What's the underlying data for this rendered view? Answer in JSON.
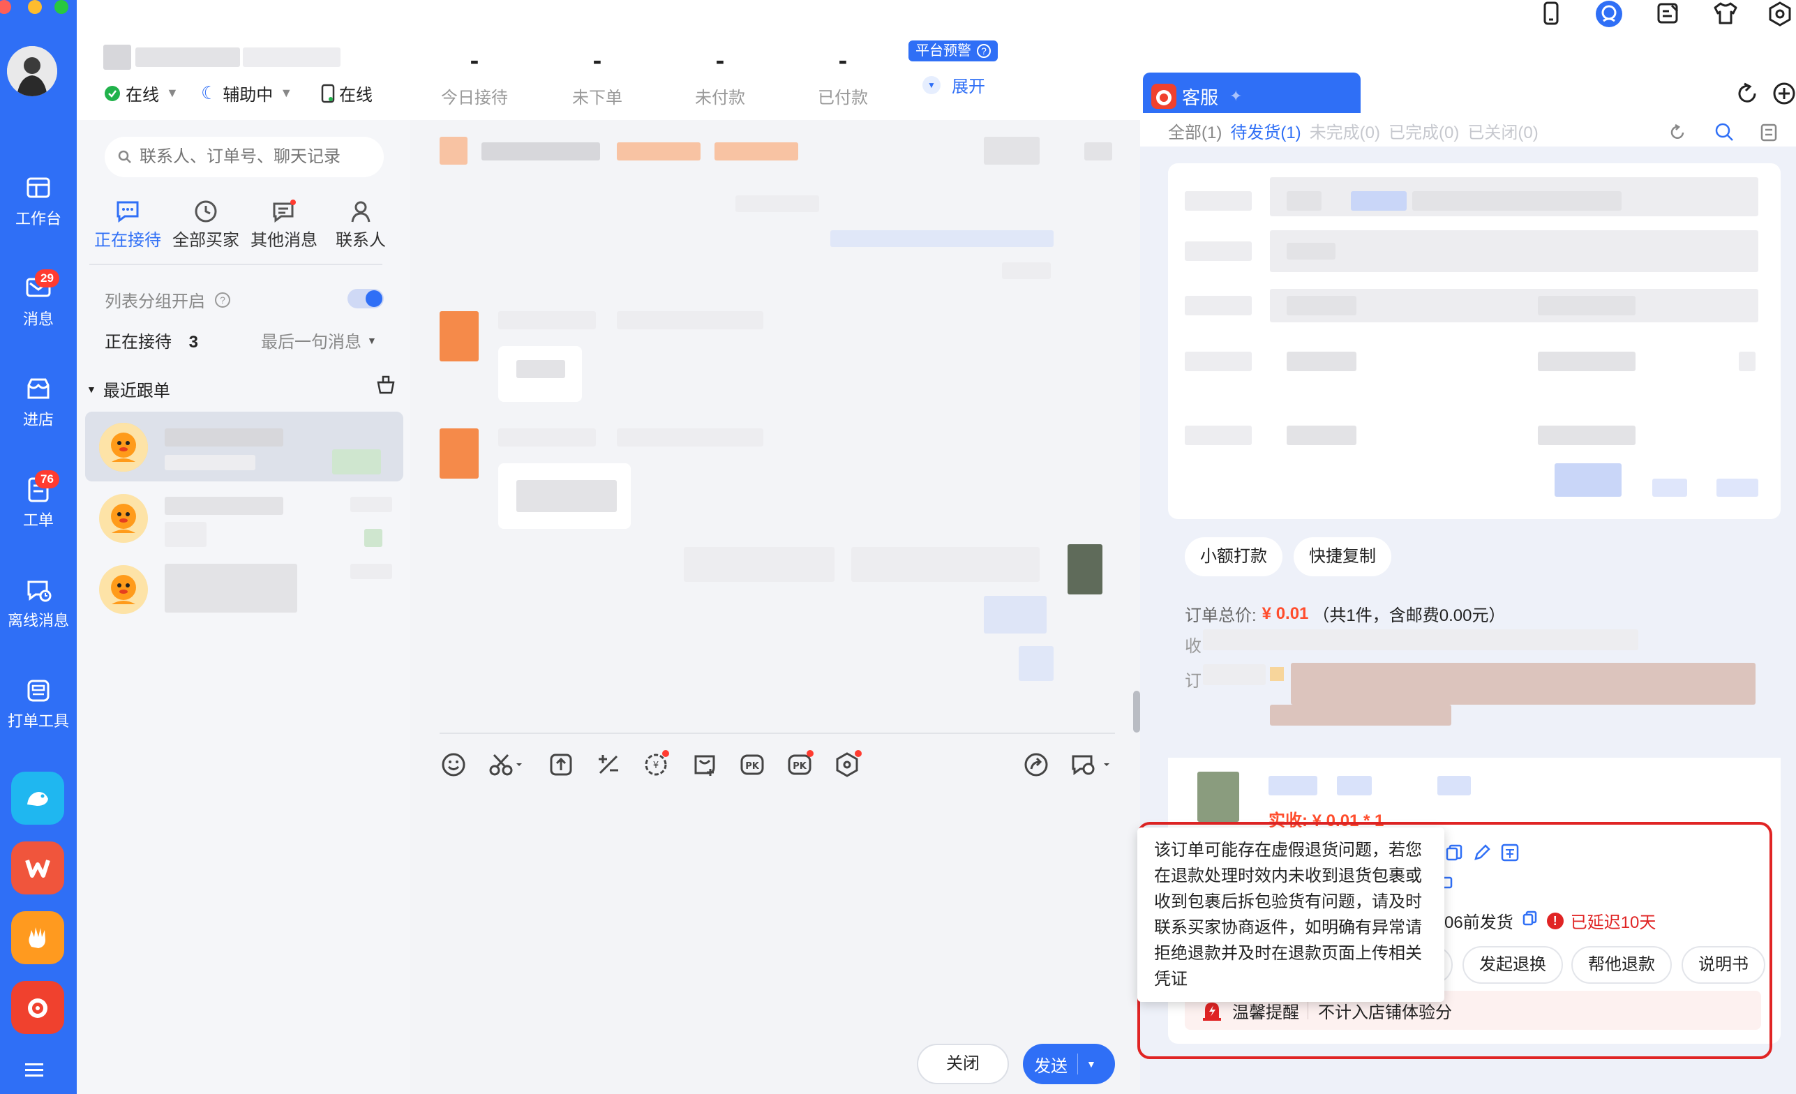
{
  "status": {
    "online_1": "在线",
    "assist": "辅助中",
    "online_2": "在线"
  },
  "stats": [
    {
      "value": "-",
      "label": "今日接待"
    },
    {
      "value": "-",
      "label": "未下单"
    },
    {
      "value": "-",
      "label": "未付款"
    },
    {
      "value": "-",
      "label": "已付款"
    }
  ],
  "platform_alert": {
    "badge": "平台预警",
    "expand": "展开"
  },
  "rail": {
    "items": [
      {
        "label": "工作台"
      },
      {
        "label": "消息",
        "badge": "29"
      },
      {
        "label": "进店"
      },
      {
        "label": "工单",
        "badge": "76"
      },
      {
        "label": "离线消息"
      },
      {
        "label": "打单工具"
      }
    ]
  },
  "list": {
    "search_placeholder": "联系人、订单号、聊天记录",
    "tabs": [
      "正在接待",
      "全部买家",
      "其他消息",
      "联系人"
    ],
    "group_toggle_label": "列表分组开启",
    "receiving_label": "正在接待",
    "receiving_count": "3",
    "sort_label": "最后一句消息",
    "recent_section": "最近跟单"
  },
  "chat": {
    "close_button": "关闭",
    "send_button": "发送"
  },
  "right": {
    "tab_title": "客服",
    "filters": [
      "全部(1)",
      "待发货(1)",
      "未完成(0)",
      "已完成(0)",
      "已关闭(0)"
    ],
    "actions_top": [
      "小额打款",
      "快捷复制"
    ],
    "order_total_label": "订单总价:",
    "order_total_value": "¥ 0.01",
    "order_total_detail": "（共1件，含邮费0.00元）",
    "row_label_1": "收",
    "row_label_2": "订",
    "actual_paid": "实收: ¥ 0.01 * 1",
    "ship_before": "06前发货",
    "delayed": "已延迟10天",
    "actions_bottom": [
      "发起退换",
      "帮他退款",
      "说明书"
    ],
    "reminder_label": "温馨提醒",
    "reminder_text": "不计入店铺体验分",
    "tooltip": "该订单可能存在虚假退货问题，若您在退款处理时效内未收到退货包裹或收到包裹后拆包验货有问题，请及时联系买家协商返件，如明确有异常请拒绝退款并及时在退款页面上传相关凭证"
  },
  "colors": {
    "rail_blue": "#2f6ff6",
    "accent_blue": "#2f6ff6",
    "price_red": "#ff4d2d",
    "alert_red": "#e02424",
    "online_green": "#21b24b"
  }
}
